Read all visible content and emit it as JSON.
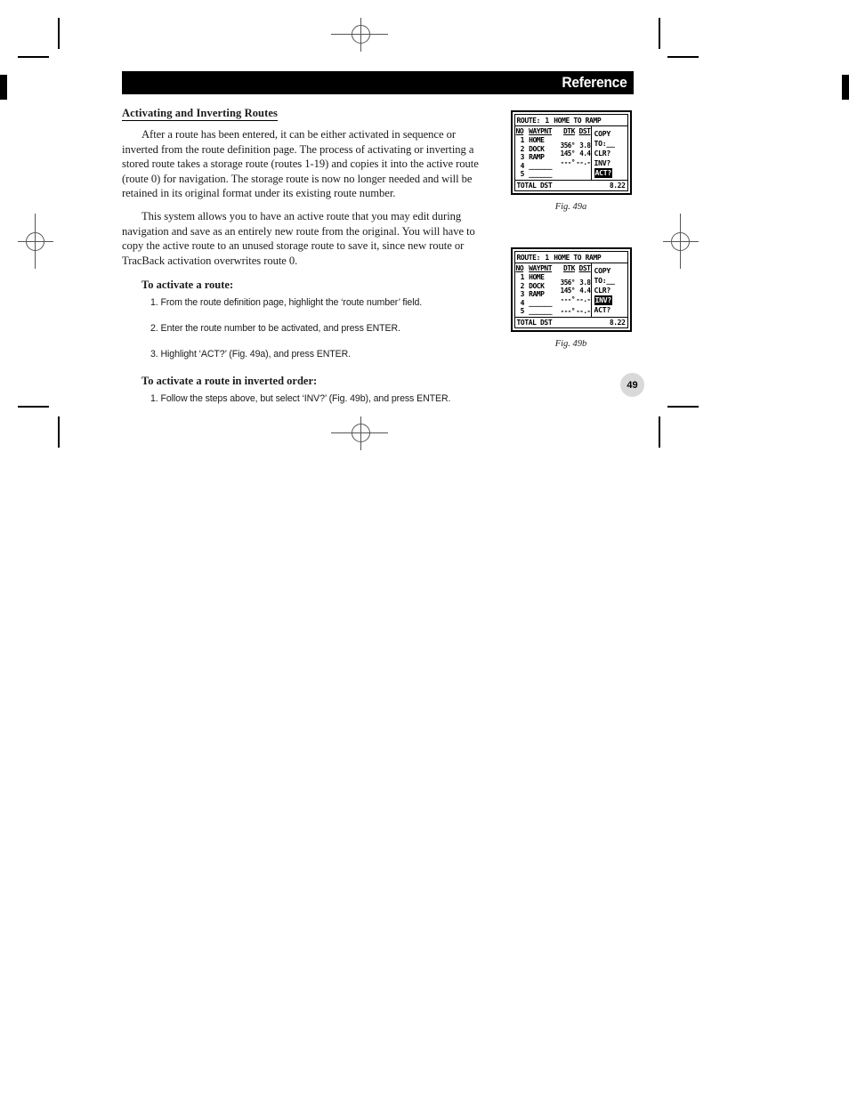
{
  "header": {
    "title": "Reference"
  },
  "page_number": "49",
  "content": {
    "section_title": "Activating and Inverting Routes",
    "paragraphs": [
      "After a route has been entered, it can be either activated in sequence or inverted from the route definition page. The process of activating or inverting a stored route takes a storage route (routes 1-19) and copies it into the active route (route 0) for navigation. The storage route is now no longer needed and will be retained in its original format under its existing route number.",
      "This system allows you to have an active route that you may edit during navigation and save as an entirely new route from the original. You will have to copy the active route to an unused storage route to save it, since new route or TracBack activation overwrites route 0."
    ],
    "procedures": [
      {
        "heading": "To activate a route:",
        "steps": [
          "1. From the route definition page, highlight the ‘route number’ field.",
          "2. Enter the route number to be activated, and press ENTER.",
          "3. Highlight ‘ACT?’ (Fig. 49a), and press ENTER."
        ]
      },
      {
        "heading": "To activate a route in inverted order:",
        "steps": [
          "1. Follow the steps above, but select ‘INV?’ (Fig. 49b), and press ENTER."
        ]
      }
    ]
  },
  "figures": [
    {
      "caption": "Fig. 49a",
      "screen": {
        "title_prefix": "ROUTE:",
        "route_number": "1",
        "title_suffix": "HOME TO RAMP",
        "columns": [
          "NO",
          "WAYPNT",
          "DTK",
          "DST"
        ],
        "rows": [
          {
            "no": "1",
            "waypoint": "HOME",
            "dtk": "",
            "dst": ""
          },
          {
            "no": "2",
            "waypoint": "DOCK",
            "dtk": "356°",
            "dst": "3.8"
          },
          {
            "no": "3",
            "waypoint": "RAMP",
            "dtk": "145°",
            "dst": "4.4"
          },
          {
            "no": "4",
            "waypoint": "______",
            "dtk": "---°",
            "dst": "--.-"
          },
          {
            "no": "5",
            "waypoint": "______",
            "dtk": "",
            "dst": ""
          }
        ],
        "menu": [
          "COPY",
          "TO:__",
          "CLR?",
          "INV?",
          "ACT?"
        ],
        "menu_selected": "ACT?",
        "total_label": "TOTAL DST",
        "total_value": "8.22"
      }
    },
    {
      "caption": "Fig. 49b",
      "screen": {
        "title_prefix": "ROUTE:",
        "route_number": "1",
        "title_suffix": "HOME TO RAMP",
        "columns": [
          "NO",
          "WAYPNT",
          "DTK",
          "DST"
        ],
        "rows": [
          {
            "no": "1",
            "waypoint": "HOME",
            "dtk": "",
            "dst": ""
          },
          {
            "no": "2",
            "waypoint": "DOCK",
            "dtk": "356°",
            "dst": "3.8"
          },
          {
            "no": "3",
            "waypoint": "RAMP",
            "dtk": "145°",
            "dst": "4.4"
          },
          {
            "no": "4",
            "waypoint": "______",
            "dtk": "---°",
            "dst": "--.-"
          },
          {
            "no": "5",
            "waypoint": "______",
            "dtk": "---°",
            "dst": "--.-"
          }
        ],
        "menu": [
          "COPY",
          "TO:__",
          "CLR?",
          "INV?",
          "ACT?"
        ],
        "menu_selected": "INV?",
        "total_label": "TOTAL DST",
        "total_value": "8.22"
      }
    }
  ]
}
